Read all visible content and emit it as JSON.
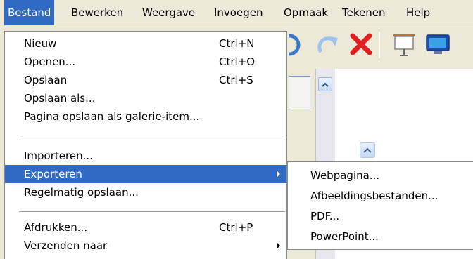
{
  "menubar": {
    "items": [
      "Bestand",
      "Bewerken",
      "Weergave",
      "Invoegen",
      "Opmaak",
      "Tekenen",
      "Help"
    ],
    "active": "Bestand"
  },
  "toolbar": {
    "icons": [
      "undo-icon",
      "redo-icon",
      "delete-icon",
      "slideshow-screen-icon",
      "monitor-icon"
    ]
  },
  "file_menu": {
    "items": [
      {
        "label": "Nieuw",
        "shortcut": "Ctrl+N"
      },
      {
        "label": "Openen...",
        "shortcut": "Ctrl+O"
      },
      {
        "label": "Opslaan",
        "shortcut": "Ctrl+S"
      },
      {
        "label": "Opslaan als...",
        "shortcut": ""
      },
      {
        "label": "Pagina opslaan als galerie-item...",
        "shortcut": ""
      },
      {
        "label": "Importeren...",
        "shortcut": ""
      },
      {
        "label": "Exporteren",
        "shortcut": ""
      },
      {
        "label": "Regelmatig opslaan...",
        "shortcut": ""
      },
      {
        "label": "Afdrukken...",
        "shortcut": "Ctrl+P"
      },
      {
        "label": "Verzenden naar",
        "shortcut": ""
      }
    ],
    "highlighted": "Exporteren"
  },
  "export_submenu": {
    "items": [
      "Webpagina...",
      "Afbeeldingsbestanden...",
      "PDF...",
      "PowerPoint..."
    ]
  },
  "colors": {
    "highlight": "#316ac5",
    "menubar_bg": "#ece9d8",
    "delete_red": "#e02020",
    "redo_blue": "#4a90d9"
  }
}
